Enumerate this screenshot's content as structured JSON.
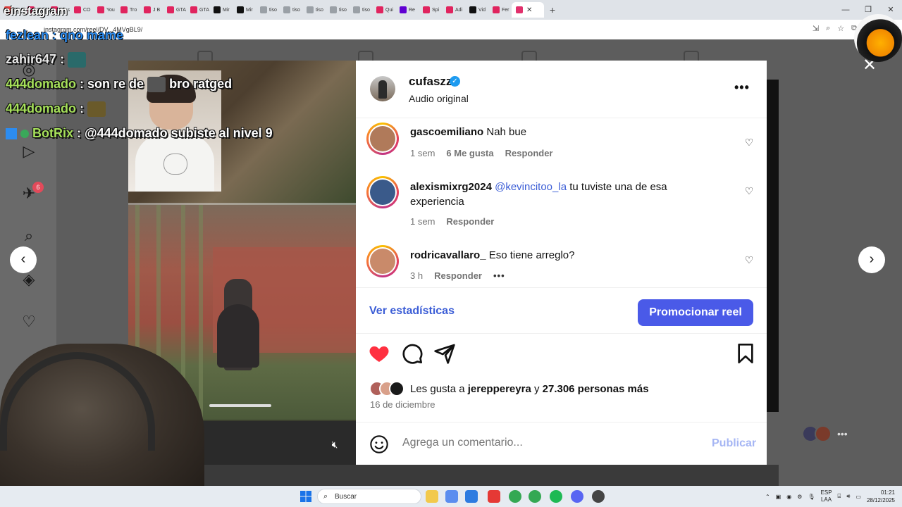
{
  "browser": {
    "tabs": [
      {
        "label": "ERA",
        "color": "#e03e3e"
      },
      {
        "label": "Cafe",
        "color": "#e0245e"
      },
      {
        "label": "Clas",
        "color": "#e0245e"
      },
      {
        "label": "CO",
        "color": "#e0245e"
      },
      {
        "label": "You",
        "color": "#e0245e"
      },
      {
        "label": "Tro",
        "color": "#e0245e"
      },
      {
        "label": "J B",
        "color": "#e0245e"
      },
      {
        "label": "GTA",
        "color": "#e0245e"
      },
      {
        "label": "GTA",
        "color": "#e0245e"
      },
      {
        "label": "Mir",
        "color": "#111111"
      },
      {
        "label": "Mir",
        "color": "#111111"
      },
      {
        "label": "tiso",
        "color": "#9aa0a6"
      },
      {
        "label": "tiso",
        "color": "#9aa0a6"
      },
      {
        "label": "tiso",
        "color": "#9aa0a6"
      },
      {
        "label": "tiso",
        "color": "#9aa0a6"
      },
      {
        "label": "tiso",
        "color": "#9aa0a6"
      },
      {
        "label": "Qui",
        "color": "#e0245e"
      },
      {
        "label": "Re",
        "color": "#6001d2"
      },
      {
        "label": "Spi",
        "color": "#e0245e"
      },
      {
        "label": "Adi",
        "color": "#e0245e"
      },
      {
        "label": "Vid",
        "color": "#111111"
      },
      {
        "label": "Fer",
        "color": "#e0245e"
      }
    ],
    "active_tab_color": "#e1306c",
    "new_tab": "+",
    "url": "instagram.com/reel/DV...4MVgBL9/"
  },
  "overlay": {
    "watermark": "einstagram",
    "streamer_label": "fezlean : qno mame",
    "chat": [
      {
        "name": "zahir647",
        "message": ":"
      },
      {
        "name": "444domado",
        "message": ": son re de",
        "extra": "bro ratged"
      },
      {
        "name": "444domado",
        "message": ":"
      },
      {
        "name": "BotRix",
        "message": ": @444domado subiste al nivel 9"
      }
    ],
    "notification_count": "6"
  },
  "reel": {
    "author": {
      "username": "cufaszz",
      "subtitle": "Audio original",
      "verified": true
    },
    "comments": [
      {
        "username": "gascoemiliano",
        "mention": "",
        "text": "Nah bue",
        "time": "1 sem",
        "likes": "6 Me gusta",
        "reply": "Responder",
        "avatar_color": "#b07a5a"
      },
      {
        "username": "alexismixrg2024",
        "mention": "@kevincitoo_la",
        "text": "tu tuviste una de esa experiencia",
        "time": "1 sem",
        "likes": "",
        "reply": "Responder",
        "avatar_color": "#3a5a8a"
      },
      {
        "username": "rodricavallaro_",
        "mention": "",
        "text": "Eso tiene arreglo?",
        "time": "3 h",
        "likes": "",
        "reply": "Responder",
        "avatar_color": "#c98a6a"
      }
    ],
    "stats_link": "Ver estadísticas",
    "promote_button": "Promocionar reel",
    "liked_by_prefix": "Les gusta a",
    "liked_by_user": "jereppereyra",
    "liked_by_conj": "y",
    "liked_by_others": "27.306 personas más",
    "date": "16 de diciembre",
    "comment_placeholder": "Agrega un comentario...",
    "publish_label": "Publicar",
    "heart_color": "#ff3040",
    "accent_color": "#4a5ae8"
  },
  "taskbar": {
    "search_placeholder": "Buscar",
    "lang_top": "ESP",
    "lang_bottom": "LAA",
    "time": "01:21",
    "date": "28/12/2025"
  }
}
